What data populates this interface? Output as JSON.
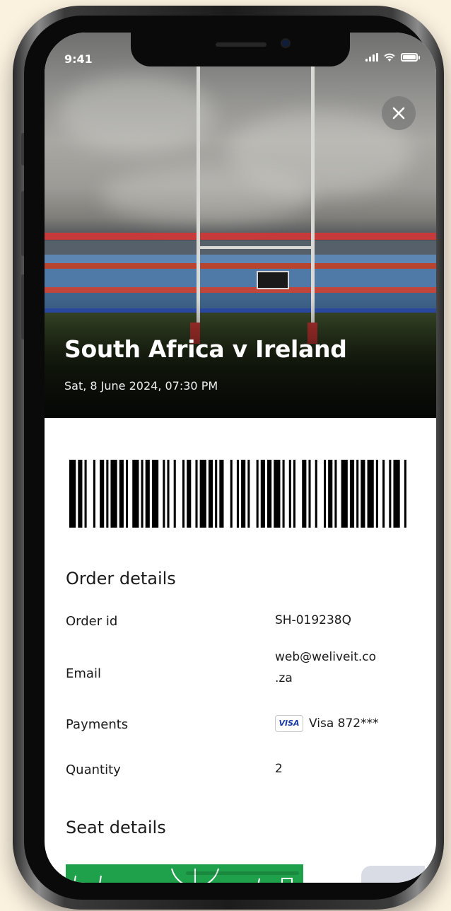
{
  "status_bar": {
    "time": "9:41"
  },
  "event": {
    "title": "South Africa v Ireland",
    "datetime": "Sat, 8 June 2024, 07:30 PM"
  },
  "barcode": {
    "icon": "barcode-icon"
  },
  "order_details": {
    "heading": "Order details",
    "rows": [
      {
        "label": "Order id",
        "value": "SH-019238Q"
      },
      {
        "label": "Email",
        "value_line1": "web@weliveit.co",
        "value_line2": ".za"
      },
      {
        "label": "Payments",
        "card_brand": "VISA",
        "value": "Visa 872***"
      },
      {
        "label": "Quantity",
        "value": "2"
      }
    ]
  },
  "seat_details": {
    "heading": "Seat details"
  },
  "colors": {
    "page_bg": "#fbf1df",
    "pitch_green": "#1fa04a",
    "visa_blue": "#1a3aa6"
  }
}
